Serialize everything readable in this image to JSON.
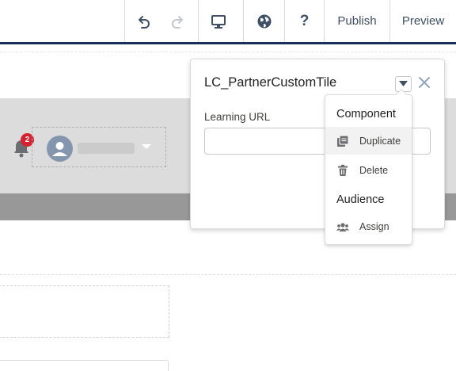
{
  "toolbar": {
    "undo_icon": "undo-icon",
    "redo_icon": "redo-icon",
    "device_icon": "desktop-icon",
    "language_icon": "globe-icon",
    "help_icon": "question-icon",
    "help_label": "?",
    "publish_label": "Publish",
    "preview_label": "Preview",
    "accent_color": "#16325c"
  },
  "canvas": {
    "notification_count": "2",
    "bell_icon": "bell-icon",
    "avatar_icon": "user-avatar-icon",
    "header_color": "#dcdcdc",
    "strip_color": "#989898"
  },
  "panel": {
    "title": "LC_PartnerCustomTile",
    "field_label": "Learning URL",
    "field_value": "",
    "menu_icon": "chevron-down-icon",
    "close_icon": "close-icon"
  },
  "menu": {
    "component_header": "Component",
    "items_component": [
      {
        "label": "Duplicate",
        "icon": "duplicate-icon"
      },
      {
        "label": "Delete",
        "icon": "trash-icon"
      }
    ],
    "audience_header": "Audience",
    "items_audience": [
      {
        "label": "Assign",
        "icon": "users-icon"
      }
    ]
  }
}
